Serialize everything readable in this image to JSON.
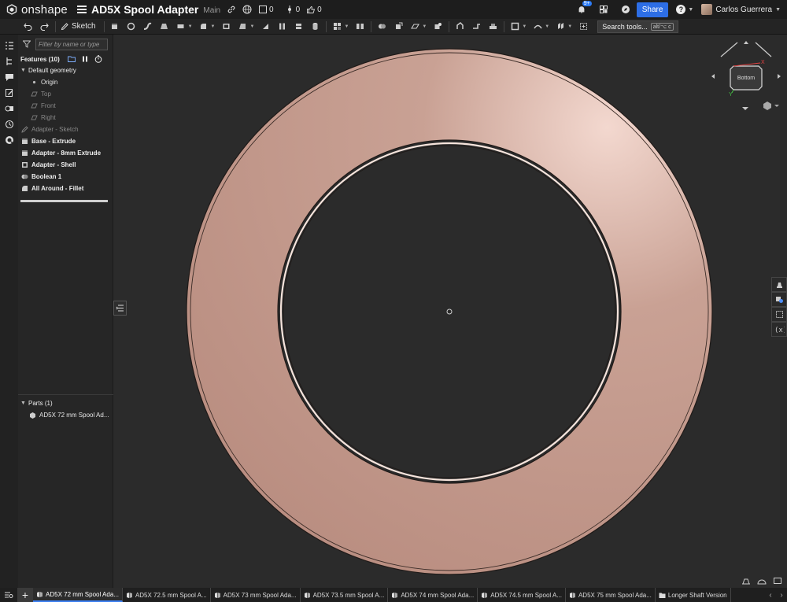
{
  "app": {
    "logo_text": "onshape",
    "document_title": "AD5X Spool Adapter",
    "branch": "Main",
    "comments_count": "0",
    "versions_count": "0",
    "likes_count": "0",
    "notifications_badge": "9+",
    "share_label": "Share",
    "user_name": "Carlos Guerrera"
  },
  "toolbar": {
    "sketch_label": "Sketch",
    "search_label": "Search tools...",
    "search_shortcut": "alt/⌥ c"
  },
  "feature_panel": {
    "filter_placeholder": "Filter by name or type",
    "features_title": "Features (10)",
    "default_geometry_label": "Default geometry",
    "default_geometry": [
      "Origin",
      "Top",
      "Front",
      "Right"
    ],
    "features": [
      {
        "name": "Adapter - Sketch",
        "icon": "sketch-icon",
        "state": "dim"
      },
      {
        "name": "Base - Extrude",
        "icon": "extrude-icon",
        "state": "bold"
      },
      {
        "name": "Adapter - 8mm Extrude",
        "icon": "extrude-icon",
        "state": "bold"
      },
      {
        "name": "Adapter - Shell",
        "icon": "shell-icon",
        "state": "bold"
      },
      {
        "name": "Boolean 1",
        "icon": "boolean-icon",
        "state": "bold"
      },
      {
        "name": "All Around - Fillet",
        "icon": "fillet-icon",
        "state": "bold"
      }
    ],
    "parts_title": "Parts (1)",
    "parts": [
      "AD5X 72 mm Spool Ad..."
    ]
  },
  "view_cube": {
    "face_label": "Bottom",
    "x_axis": "X",
    "y_axis": "Y"
  },
  "tabs": [
    {
      "label": "AD5X 72 mm Spool Ada...",
      "type": "part-studio",
      "active": true
    },
    {
      "label": "AD5X 72.5 mm Spool A...",
      "type": "part-studio",
      "active": false
    },
    {
      "label": "AD5X 73 mm Spool Ada...",
      "type": "part-studio",
      "active": false
    },
    {
      "label": "AD5X 73.5 mm Spool A...",
      "type": "part-studio",
      "active": false
    },
    {
      "label": "AD5X 74 mm Spool Ada...",
      "type": "part-studio",
      "active": false
    },
    {
      "label": "AD5X 74.5 mm Spool A...",
      "type": "part-studio",
      "active": false
    },
    {
      "label": "AD5X 75 mm Spool Ada...",
      "type": "part-studio",
      "active": false
    },
    {
      "label": "Longer Shaft Version",
      "type": "folder",
      "active": false
    }
  ],
  "colors": {
    "part_color": "#c49a8c",
    "accent": "#2d6ee6",
    "background": "#2b2b2b"
  }
}
